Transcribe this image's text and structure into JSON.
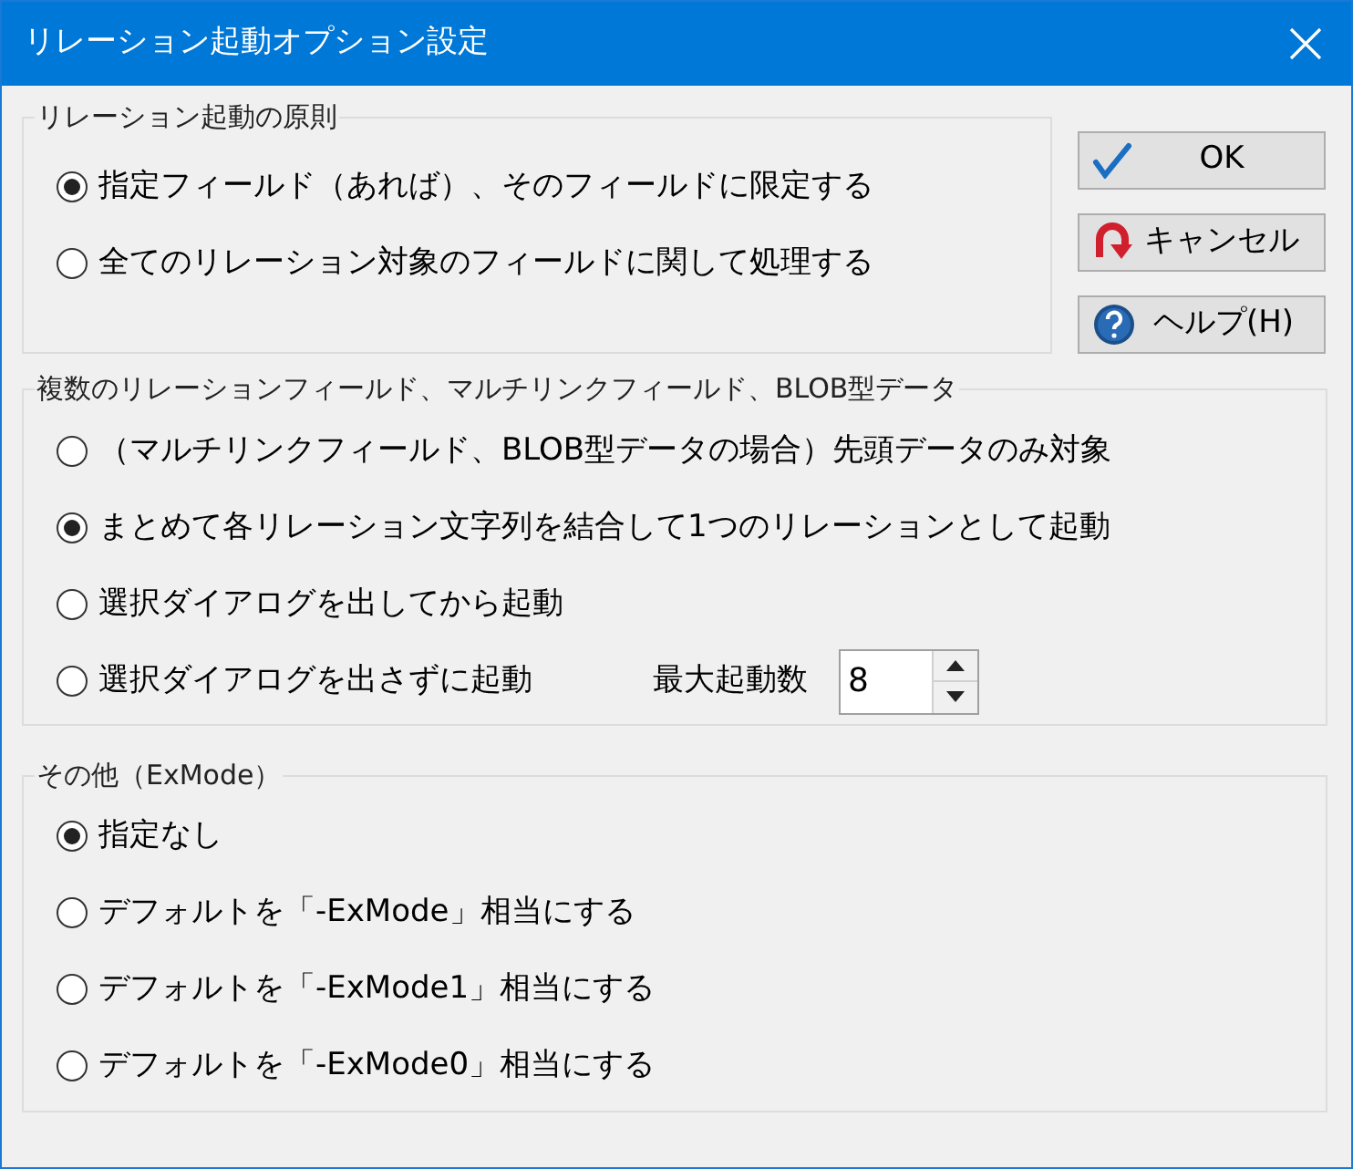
{
  "window": {
    "title": "リレーション起動オプション設定"
  },
  "groups": [
    {
      "title": "リレーション起動の原則",
      "options": [
        {
          "label": "指定フィールド（あれば）、そのフィールドに限定する",
          "selected": true
        },
        {
          "label": "全てのリレーション対象のフィールドに関して処理する",
          "selected": false
        }
      ]
    },
    {
      "title": "複数のリレーションフィールド、マルチリンクフィールド、BLOB型データ",
      "options": [
        {
          "label": "（マルチリンクフィールド、BLOB型データの場合）先頭データのみ対象",
          "selected": false
        },
        {
          "label": "まとめて各リレーション文字列を結合して1つのリレーションとして起動",
          "selected": true
        },
        {
          "label": "選択ダイアログを出してから起動",
          "selected": false
        },
        {
          "label": "選択ダイアログを出さずに起動",
          "selected": false
        }
      ],
      "spinner": {
        "label": "最大起動数",
        "value": "8"
      }
    },
    {
      "title": "その他（ExMode）",
      "options": [
        {
          "label": "指定なし",
          "selected": true
        },
        {
          "label": "デフォルトを「-ExMode」相当にする",
          "selected": false
        },
        {
          "label": "デフォルトを「-ExMode1」相当にする",
          "selected": false
        },
        {
          "label": "デフォルトを「-ExMode0」相当にする",
          "selected": false
        }
      ]
    }
  ],
  "buttons": [
    {
      "label": "OK",
      "kind": "ok"
    },
    {
      "label": "キャンセル",
      "kind": "cancel"
    },
    {
      "label": "ヘルプ(H)",
      "kind": "help"
    }
  ]
}
